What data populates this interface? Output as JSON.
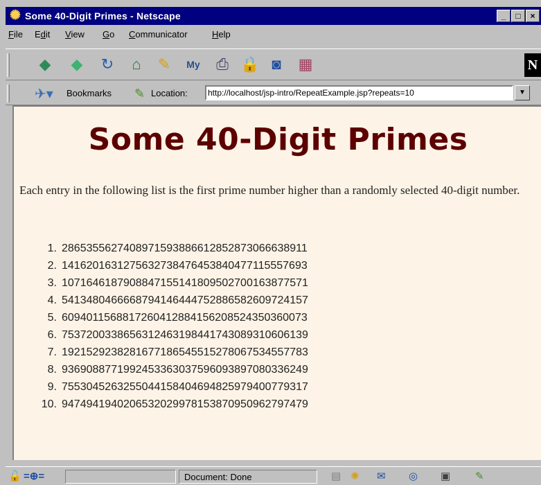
{
  "window": {
    "title": "Some 40-Digit Primes - Netscape",
    "buttons": [
      "_",
      "□",
      "×"
    ]
  },
  "menu": [
    {
      "pre": "",
      "key": "F",
      "post": "ile"
    },
    {
      "pre": "E",
      "key": "d",
      "post": "it"
    },
    {
      "pre": "",
      "key": "V",
      "post": "iew"
    },
    {
      "pre": "",
      "key": "G",
      "post": "o"
    },
    {
      "pre": "",
      "key": "C",
      "post": "ommunicator"
    },
    {
      "pre": "",
      "key": "H",
      "post": "elp"
    }
  ],
  "toolbar": {
    "icons": [
      "back-icon",
      "forward-icon",
      "reload-icon",
      "home-icon",
      "search-icon",
      "my-netscape-icon",
      "print-icon",
      "security-icon",
      "shop-icon",
      "stop-icon"
    ],
    "logo": "N"
  },
  "location_bar": {
    "bookmarks_label": "Bookmarks",
    "location_label": "Location:",
    "url": "http://localhost/jsp-intro/RepeatExample.jsp?repeats=10"
  },
  "page": {
    "heading": "Some 40-Digit Primes",
    "intro": "Each entry in the following list is the first prime number higher than a randomly selected 40-digit number.",
    "primes": [
      "2865355627408971593886612852873066638911",
      "1416201631275632738476453840477115557693",
      "1071646187908847155141809502700163877571",
      "5413480466668794146444752886582609724157",
      "6094011568817260412884156208524350360073",
      "7537200338656312463198441743089310606139",
      "1921529238281677186545515278067534557783",
      "9369088771992453363037596093897080336249",
      "7553045263255044158404694825979400779317",
      "9474941940206532029978153870950962797479"
    ]
  },
  "status": {
    "text": "Document: Done"
  },
  "colors": {
    "titlebar": "#000080",
    "heading": "#5c0000",
    "page_background": "#fdf3e6",
    "chrome": "#c0c0c0"
  }
}
